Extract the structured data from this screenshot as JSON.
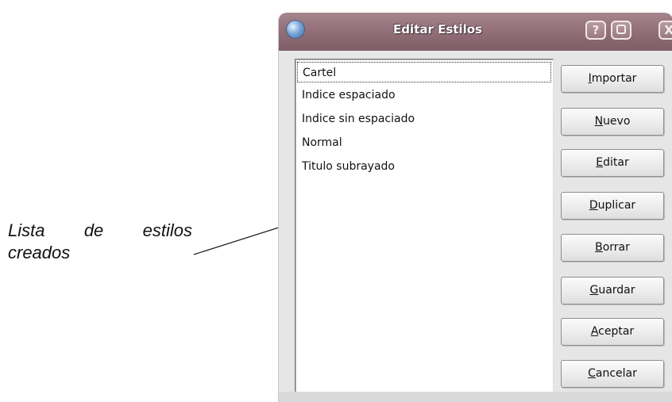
{
  "annotation": {
    "line1_words": [
      "Lista",
      "de",
      "estilos"
    ],
    "line2": "creados"
  },
  "window": {
    "title": "Editar Estilos",
    "title_buttons": {
      "help": "?",
      "maximize": "□",
      "close": "X"
    }
  },
  "styles_list": [
    "Cartel",
    "Indice espaciado",
    "Indice sin espaciado",
    "Normal",
    "Titulo subrayado"
  ],
  "buttons": [
    {
      "mnemonic": "I",
      "rest": "mportar"
    },
    {
      "mnemonic": "N",
      "rest": "uevo"
    },
    {
      "mnemonic": "E",
      "rest": "ditar"
    },
    {
      "mnemonic": "D",
      "rest": "uplicar"
    },
    {
      "mnemonic": "B",
      "rest": "orrar"
    },
    {
      "mnemonic": "G",
      "rest": "uardar"
    },
    {
      "mnemonic": "A",
      "rest": "ceptar"
    },
    {
      "mnemonic": "C",
      "rest": "ancelar"
    }
  ],
  "colors": {
    "titlebar": "#93707a",
    "dialog_bg": "#e6e6e6",
    "list_bg": "#ffffff"
  }
}
